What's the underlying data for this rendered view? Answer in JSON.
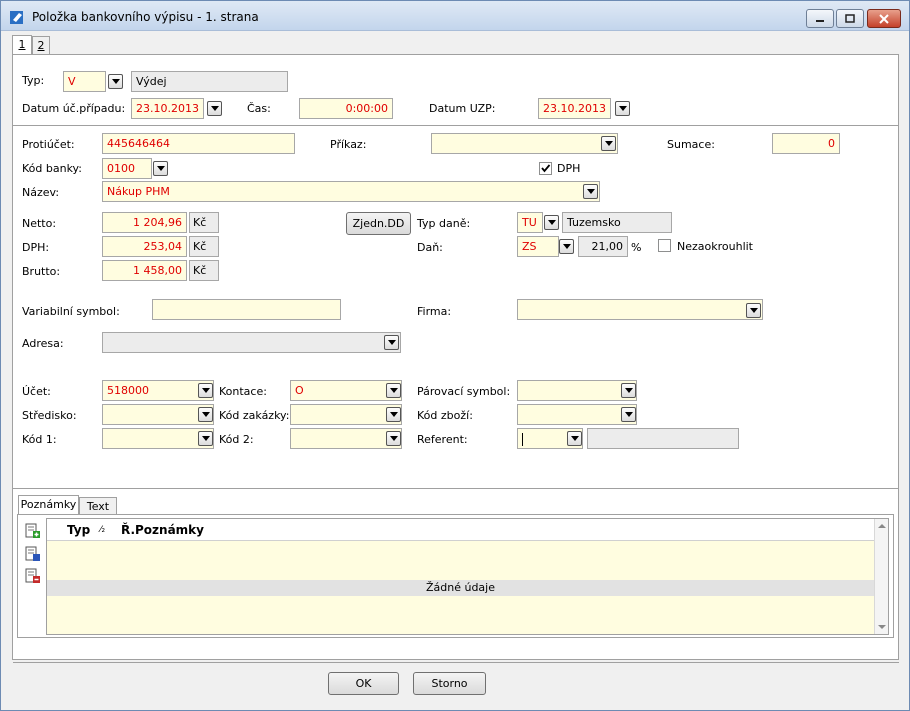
{
  "window": {
    "title": "Položka bankovního výpisu - 1. strana"
  },
  "top_tabs": [
    "1",
    "2"
  ],
  "typ": {
    "label": "Typ:",
    "code": "V",
    "desc": "Výdej"
  },
  "datum_uc": {
    "label": "Datum úč.případu:",
    "value": "23.10.2013"
  },
  "cas": {
    "label": "Čas:",
    "value": "0:00:00"
  },
  "datum_uzp": {
    "label": "Datum UZP:",
    "value": "23.10.2013"
  },
  "protiucet": {
    "label": "Protiúčet:",
    "value": "445646464"
  },
  "prikaz": {
    "label": "Příkaz:",
    "value": ""
  },
  "sumace": {
    "label": "Sumace:",
    "value": "0"
  },
  "kod_banky": {
    "label": "Kód banky:",
    "value": "0100"
  },
  "dph_check": {
    "label": "DPH",
    "checked": true
  },
  "nazev": {
    "label": "Název:",
    "value": "Nákup PHM"
  },
  "netto": {
    "label": "Netto:",
    "value": "1 204,96",
    "unit": "Kč"
  },
  "dph": {
    "label": "DPH:",
    "value": "253,04",
    "unit": "Kč"
  },
  "brutto": {
    "label": "Brutto:",
    "value": "1 458,00",
    "unit": "Kč"
  },
  "zjedn_button": "Zjedn.DD",
  "typ_dane": {
    "label": "Typ daně:",
    "code": "TU",
    "desc": "Tuzemsko"
  },
  "dan": {
    "label": "Daň:",
    "code": "ZS",
    "rate": "21,00",
    "unit": "%"
  },
  "nezaokrouhlit": {
    "label": "Nezaokrouhlit",
    "checked": false
  },
  "variabilni_symbol": {
    "label": "Variabilní symbol:",
    "value": ""
  },
  "firma": {
    "label": "Firma:",
    "value": ""
  },
  "adresa": {
    "label": "Adresa:",
    "value": ""
  },
  "ucet": {
    "label": "Účet:",
    "value": "518000"
  },
  "kontace": {
    "label": "Kontace:",
    "value": "O"
  },
  "parovaci_symbol": {
    "label": "Párovací symbol:",
    "value": ""
  },
  "stredisko": {
    "label": "Středisko:",
    "value": ""
  },
  "kod_zakazky": {
    "label": "Kód zakázky:",
    "value": ""
  },
  "kod_zbozi": {
    "label": "Kód zboží:",
    "value": ""
  },
  "kod1": {
    "label": "Kód 1:",
    "value": ""
  },
  "kod2": {
    "label": "Kód 2:",
    "value": ""
  },
  "referent": {
    "label": "Referent:",
    "value": "",
    "desc": ""
  },
  "bottom_tabs": [
    "Poznámky",
    "Text"
  ],
  "notes_table": {
    "columns": [
      "Typ",
      "⁄₂",
      "Ř.",
      "Poznámky"
    ],
    "empty_text": "Žádné údaje"
  },
  "buttons": {
    "ok": "OK",
    "storno": "Storno"
  },
  "colors": {
    "field_bg": "#fffde0",
    "value_red": "#e00000",
    "title_bar": "#c3d5ec"
  }
}
